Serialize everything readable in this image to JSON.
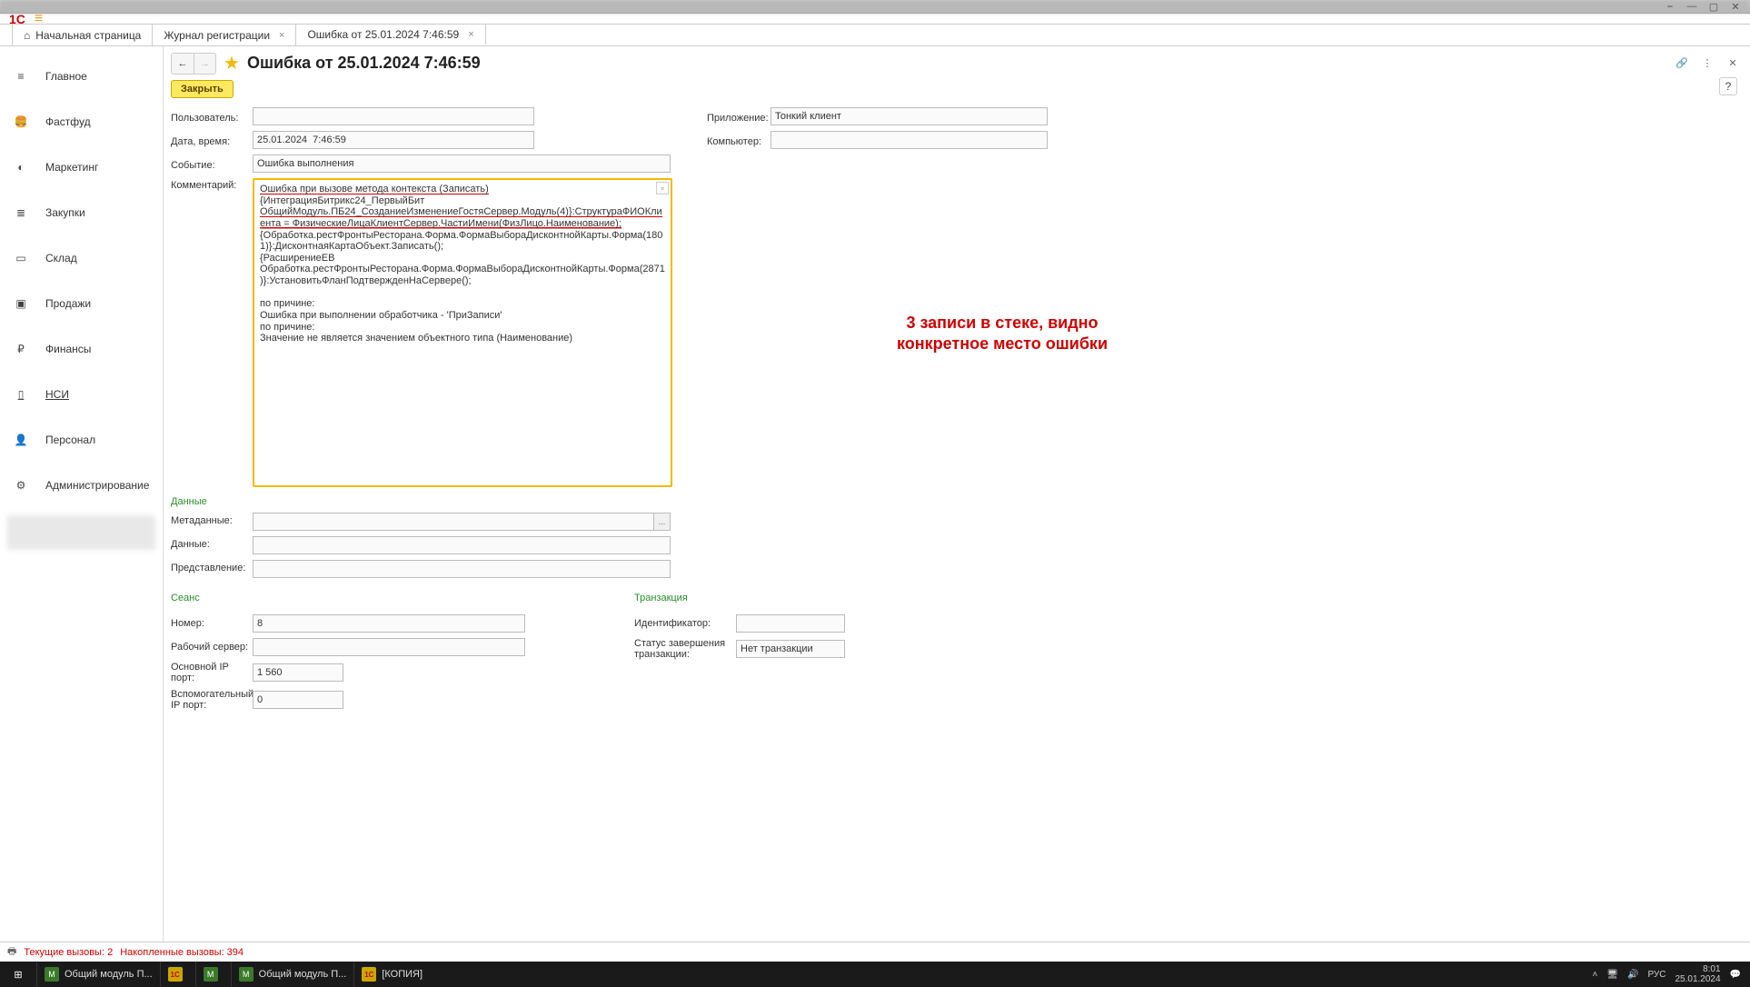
{
  "tabs": {
    "home": "Начальная страница",
    "log": "Журнал регистрации",
    "error": "Ошибка от 25.01.2024 7:46:59"
  },
  "sidebar": [
    {
      "id": "main",
      "label": "Главное",
      "icon": "≡"
    },
    {
      "id": "fastfood",
      "label": "Фастфуд",
      "icon": "🍔"
    },
    {
      "id": "marketing",
      "label": "Маркетинг",
      "icon": "◐"
    },
    {
      "id": "purch",
      "label": "Закупки",
      "icon": "≣"
    },
    {
      "id": "wh",
      "label": "Склад",
      "icon": "▭"
    },
    {
      "id": "sales",
      "label": "Продажи",
      "icon": "▣"
    },
    {
      "id": "fin",
      "label": "Финансы",
      "icon": "₽"
    },
    {
      "id": "nsi",
      "label": "НСИ",
      "icon": "▯",
      "u": true
    },
    {
      "id": "pers",
      "label": "Персонал",
      "icon": "👤"
    },
    {
      "id": "admin",
      "label": "Администрирование",
      "icon": "⚙"
    }
  ],
  "page": {
    "title": "Ошибка от 25.01.2024 7:46:59",
    "close_btn": "Закрыть"
  },
  "top_fields": {
    "user_label": "Пользователь:",
    "user_value": "",
    "app_label": "Приложение:",
    "app_value": "Тонкий клиент",
    "dt_label": "Дата, время:",
    "dt_value": "25.01.2024  7:46:59",
    "computer_label": "Компьютер:",
    "computer_value": "",
    "event_label": "Событие:",
    "event_value": "Ошибка выполнения",
    "comment_label": "Комментарий:"
  },
  "comment": {
    "l1": "Ошибка при вызове метода контекста (Записать)",
    "l2": "{ИнтеграцияБитрикс24_ПервыйБит",
    "l3": "ОбщийМодуль.ПБ24_СозданиеИзменениеГостяСервер.Модуль(4)}:СтруктураФИОКлиента = ФизическиеЛицаКлиентСервер.ЧастиИмени(ФизЛицо.Наименование);",
    "l4": "{Обработка.рестФронтыРесторана.Форма.ФормаВыбораДисконтнойКарты.Форма(1801)}:ДисконтнаяКартаОбъект.Записать();",
    "l5": "{РасширениеЕВ",
    "l6": "Обработка.рестФронтыРесторана.Форма.ФормаВыбораДисконтнойКарты.Форма(2871)}:УстановитьФланПодтвержденНаСервере();",
    "l7": "",
    "l8": "по причине:",
    "l9": "Ошибка при выполнении обработчика - 'ПриЗаписи'",
    "l10": "по причине:",
    "l11": "Значение не является значением объектного типа (Наименование)"
  },
  "annotation": "3 записи в стеке, видно конкретное место ошибки",
  "data_section": {
    "title": "Данные",
    "meta_label": "Метаданные:",
    "data_label": "Данные:",
    "repr_label": "Представление:"
  },
  "session": {
    "title": "Сеанс",
    "num_label": "Номер:",
    "num_value": "8",
    "server_label": "Рабочий сервер:",
    "server_value": "",
    "mainport_label": "Основной IP порт:",
    "mainport_value": "1 560",
    "auxport_label": "Вспомогательный IP порт:",
    "auxport_value": "0"
  },
  "transaction": {
    "title": "Транзакция",
    "id_label": "Идентификатор:",
    "status_label": "Статус завершения транзакции:",
    "status_value": "Нет транзакции"
  },
  "statusbar": {
    "calls": "Текущие вызовы: 2",
    "acc": "Накопленные вызовы: 394"
  },
  "taskbar": {
    "items": [
      {
        "icon": "g",
        "label": "Общий модуль П..."
      },
      {
        "icon": "y",
        "label": ""
      },
      {
        "icon": "g",
        "label": ""
      },
      {
        "icon": "g",
        "label": "Общий модуль П..."
      },
      {
        "icon": "y",
        "label": "[КОПИЯ]"
      }
    ],
    "lang": "РУС",
    "time": "8:01",
    "date": "25.01.2024"
  }
}
